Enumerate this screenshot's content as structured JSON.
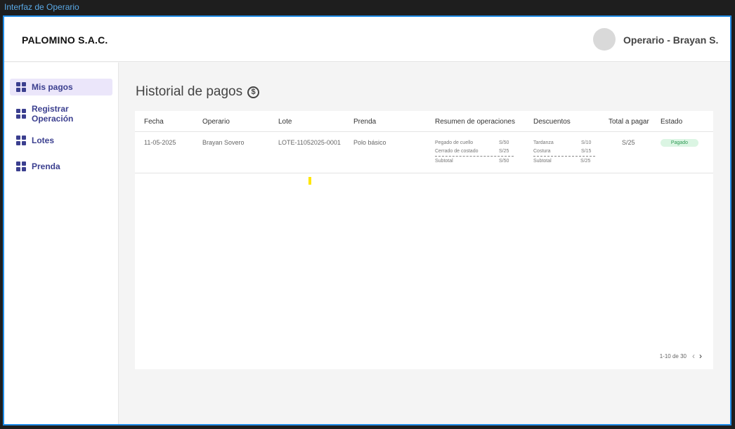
{
  "window": {
    "title": "Interfaz de Operario"
  },
  "header": {
    "brand": "PALOMINO S.A.C.",
    "user": "Operario - Brayan S."
  },
  "sidebar": {
    "items": [
      {
        "label": "Mis pagos",
        "active": true
      },
      {
        "label": "Registrar Operación",
        "active": false
      },
      {
        "label": "Lotes",
        "active": false
      },
      {
        "label": "Prenda",
        "active": false
      }
    ]
  },
  "main": {
    "title": "Historial de pagos",
    "title_icon": "dollar-circle-icon"
  },
  "table": {
    "headers": [
      "Fecha",
      "Operario",
      "Lote",
      "Prenda",
      "Resumen de operaciones",
      "Descuentos",
      "Total a pagar",
      "Estado"
    ],
    "rows": [
      {
        "fecha": "11-05-2025",
        "operario": "Brayan Sovero",
        "lote": "LOTE-11052025-0001",
        "prenda": "Polo básico",
        "operaciones": [
          {
            "name": "Pegado de cuello",
            "amount": "S/50"
          },
          {
            "name": "Cerrado de costado",
            "amount": "S/25"
          }
        ],
        "operaciones_subtotal": {
          "label": "Subtotal",
          "amount": "S/50"
        },
        "descuentos": [
          {
            "name": "Tardanza",
            "amount": "S/10"
          },
          {
            "name": "Costura",
            "amount": "S/15"
          }
        ],
        "descuentos_subtotal": {
          "label": "Subtotal",
          "amount": "S/25"
        },
        "total": "S/25",
        "estado": "Pagado"
      }
    ]
  },
  "pagination": {
    "text": "1-10 de 30",
    "prev": "‹",
    "next": "›"
  },
  "colors": {
    "accent": "#3b3f8f",
    "active_bg": "#ebe6fa",
    "badge_bg": "#dbf5e3",
    "badge_text": "#2f9a55",
    "frame_border": "#1f8be6"
  }
}
